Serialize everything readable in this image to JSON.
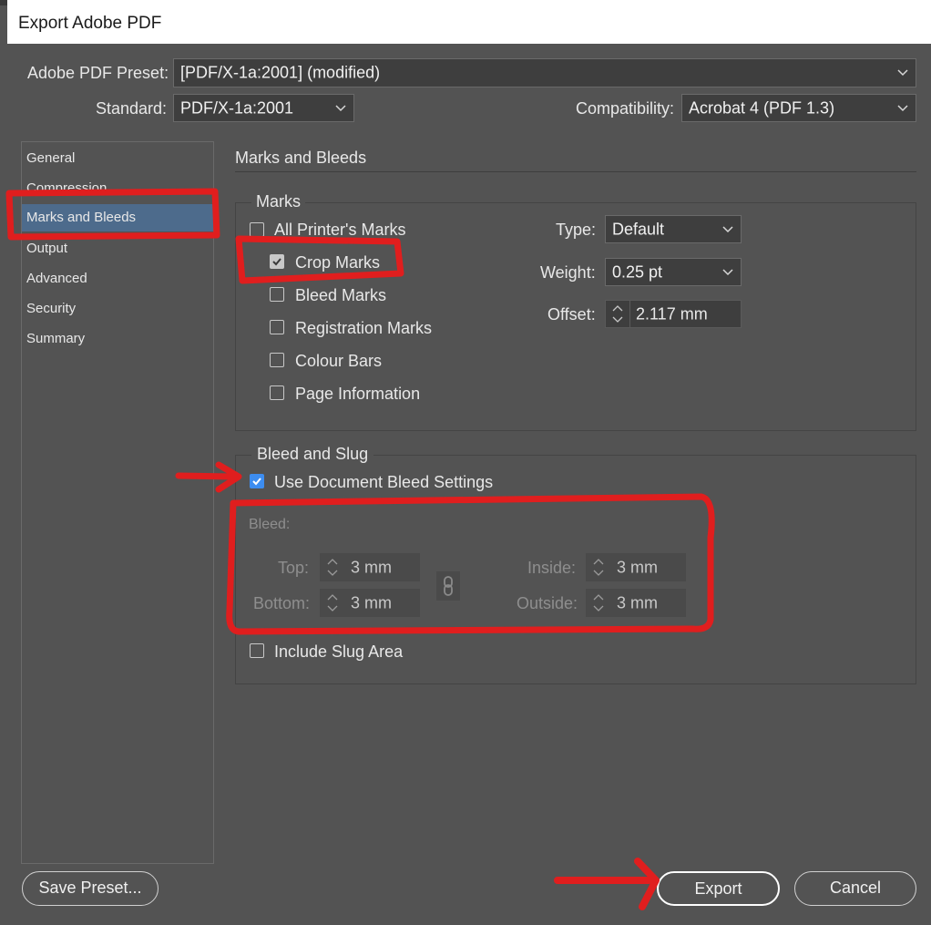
{
  "window": {
    "title": "Export Adobe PDF"
  },
  "preset": {
    "label": "Adobe PDF Preset:",
    "value": "[PDF/X-1a:2001] (modified)"
  },
  "standard": {
    "label": "Standard:",
    "value": "PDF/X-1a:2001"
  },
  "compatibility": {
    "label": "Compatibility:",
    "value": "Acrobat 4 (PDF 1.3)"
  },
  "sidebar": {
    "items": [
      {
        "label": "General"
      },
      {
        "label": "Compression"
      },
      {
        "label": "Marks and Bleeds",
        "selected": true
      },
      {
        "label": "Output"
      },
      {
        "label": "Advanced"
      },
      {
        "label": "Security"
      },
      {
        "label": "Summary"
      }
    ]
  },
  "panel": {
    "title": "Marks and Bleeds"
  },
  "marks": {
    "group_title": "Marks",
    "all_printers_marks": {
      "label": "All Printer's Marks",
      "checked": false
    },
    "crop_marks": {
      "label": "Crop Marks",
      "checked": true
    },
    "bleed_marks": {
      "label": "Bleed Marks",
      "checked": false
    },
    "registration_marks": {
      "label": "Registration Marks",
      "checked": false
    },
    "colour_bars": {
      "label": "Colour Bars",
      "checked": false
    },
    "page_information": {
      "label": "Page Information",
      "checked": false
    },
    "type": {
      "label": "Type:",
      "value": "Default"
    },
    "weight": {
      "label": "Weight:",
      "value": "0.25 pt"
    },
    "offset": {
      "label": "Offset:",
      "value": "2.117 mm"
    }
  },
  "bleed": {
    "group_title": "Bleed and Slug",
    "use_document": {
      "label": "Use Document Bleed Settings",
      "checked": true
    },
    "section_label": "Bleed:",
    "top": {
      "label": "Top:",
      "value": "3 mm"
    },
    "bottom": {
      "label": "Bottom:",
      "value": "3 mm"
    },
    "inside": {
      "label": "Inside:",
      "value": "3 mm"
    },
    "outside": {
      "label": "Outside:",
      "value": "3 mm"
    },
    "include_slug": {
      "label": "Include Slug Area",
      "checked": false
    }
  },
  "buttons": {
    "save_preset": "Save Preset...",
    "export": "Export",
    "cancel": "Cancel"
  },
  "colors": {
    "background": "#535353",
    "selection": "#4d6b8c",
    "checkbox_blue": "#3d8df0",
    "annotation_red": "#e01e1e"
  }
}
